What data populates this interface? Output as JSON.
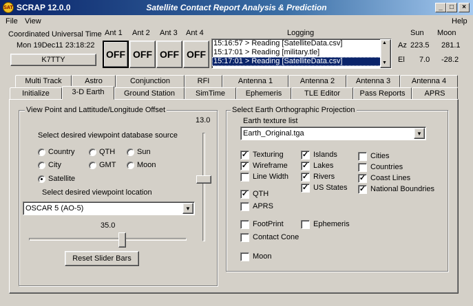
{
  "window": {
    "app_badge": "SAT",
    "app_name": "SCRAP  12.0.0",
    "title": "Satellite Contact Report Analysis & Prediction",
    "minimize": "_",
    "maximize": "□",
    "close": "×"
  },
  "menu": {
    "file": "File",
    "view": "View",
    "help": "Help"
  },
  "utc": {
    "label": "Coordinated Universal Time",
    "datetime": "Mon 19Dec11 23:18:22",
    "callsign": "K7TTY"
  },
  "antennas": [
    {
      "label": "Ant 1",
      "state": "OFF"
    },
    {
      "label": "Ant 2",
      "state": "OFF"
    },
    {
      "label": "Ant 3",
      "state": "OFF"
    },
    {
      "label": "Ant 4",
      "state": "OFF"
    }
  ],
  "logging": {
    "label": "Logging",
    "lines": [
      "15:16:57 > Reading [SatelliteData.csv]",
      "15:17:01 > Reading [military.tle]",
      "15:17:01 > Reading [SatelliteData.csv]"
    ]
  },
  "sunmoon": {
    "sun_label": "Sun",
    "moon_label": "Moon",
    "az_label": "Az",
    "el_label": "El",
    "sun_az": "223.5",
    "moon_az": "281.1",
    "sun_el": "7.0",
    "moon_el": "-28.2"
  },
  "tabs_row1": [
    "Multi Track",
    "Astro",
    "Conjunction",
    "RFI",
    "Antenna 1",
    "Antenna 2",
    "Antenna 3",
    "Antenna 4"
  ],
  "tabs_row2": [
    "Initialize",
    "3-D Earth",
    "Ground Station",
    "SimTime",
    "Ephemeris",
    "TLE Editor",
    "Pass Reports",
    "APRS"
  ],
  "viewpoint": {
    "frame_title": "View Point and Lattitude/Longitude Offset",
    "source_label": "Select desired viewpoint database source",
    "sources": [
      {
        "label": "Country",
        "selected": false
      },
      {
        "label": "QTH",
        "selected": false
      },
      {
        "label": "Sun",
        "selected": false
      },
      {
        "label": "City",
        "selected": false
      },
      {
        "label": "GMT",
        "selected": false
      },
      {
        "label": "Moon",
        "selected": false
      },
      {
        "label": "Satellite",
        "selected": true
      }
    ],
    "location_label": "Select desired viewpoint location",
    "location_value": "OSCAR 5 (AO-5)",
    "hslider_value": "35.0",
    "vslider_value": "13.0",
    "reset_label": "Reset Slider Bars"
  },
  "projection": {
    "frame_title": "Select Earth Orthographic Projection",
    "texture_label": "Earth texture list",
    "texture_value": "Earth_Original.tga",
    "options": [
      {
        "label": "Texturing",
        "checked": true
      },
      {
        "label": "Wireframe",
        "checked": true
      },
      {
        "label": "Line Width",
        "checked": false
      },
      {
        "label": "QTH",
        "checked": true
      },
      {
        "label": "APRS",
        "checked": false
      },
      {
        "label": "Islands",
        "checked": true
      },
      {
        "label": "Lakes",
        "checked": true
      },
      {
        "label": "Rivers",
        "checked": true
      },
      {
        "label": "US States",
        "checked": true
      },
      {
        "label": "Cities",
        "checked": false
      },
      {
        "label": "Countries",
        "checked": false
      },
      {
        "label": "Coast Lines",
        "checked": true
      },
      {
        "label": "National Boundries",
        "checked": true
      },
      {
        "label": "FootPrint",
        "checked": false
      },
      {
        "label": "Ephemeris",
        "checked": false
      },
      {
        "label": "Contact Cone",
        "checked": false
      },
      {
        "label": "Moon",
        "checked": false
      }
    ]
  },
  "check_mark": "✓",
  "dropdown_arrow": "▼"
}
